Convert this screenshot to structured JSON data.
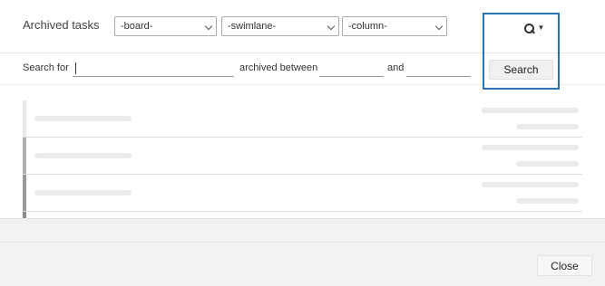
{
  "dialog": {
    "title": "Archived tasks"
  },
  "filters": {
    "board": {
      "selected": "-board-"
    },
    "swimlane": {
      "selected": "-swimlane-"
    },
    "column": {
      "selected": "-column-"
    }
  },
  "search_toggle": {
    "icon": "search-icon",
    "caret": "▼"
  },
  "search_form": {
    "search_for_label": "Search for",
    "query_value": "",
    "archived_between_label": "archived between",
    "from_value": "",
    "and_label": "and",
    "to_value": "",
    "search_button_label": "Search"
  },
  "results": {
    "state": "loading",
    "rows": [
      {
        "bar_color": "#e8e8e8"
      },
      {
        "bar_color": "#b0b0b0"
      },
      {
        "bar_color": "#9a9a9a"
      },
      {
        "bar_color": "#8c8c8c"
      }
    ]
  },
  "footer": {
    "close_label": "Close"
  },
  "colors": {
    "highlight_outline": "#2a72b5",
    "placeholder": "#ebebeb",
    "footer_bg": "#f2f2f2"
  }
}
